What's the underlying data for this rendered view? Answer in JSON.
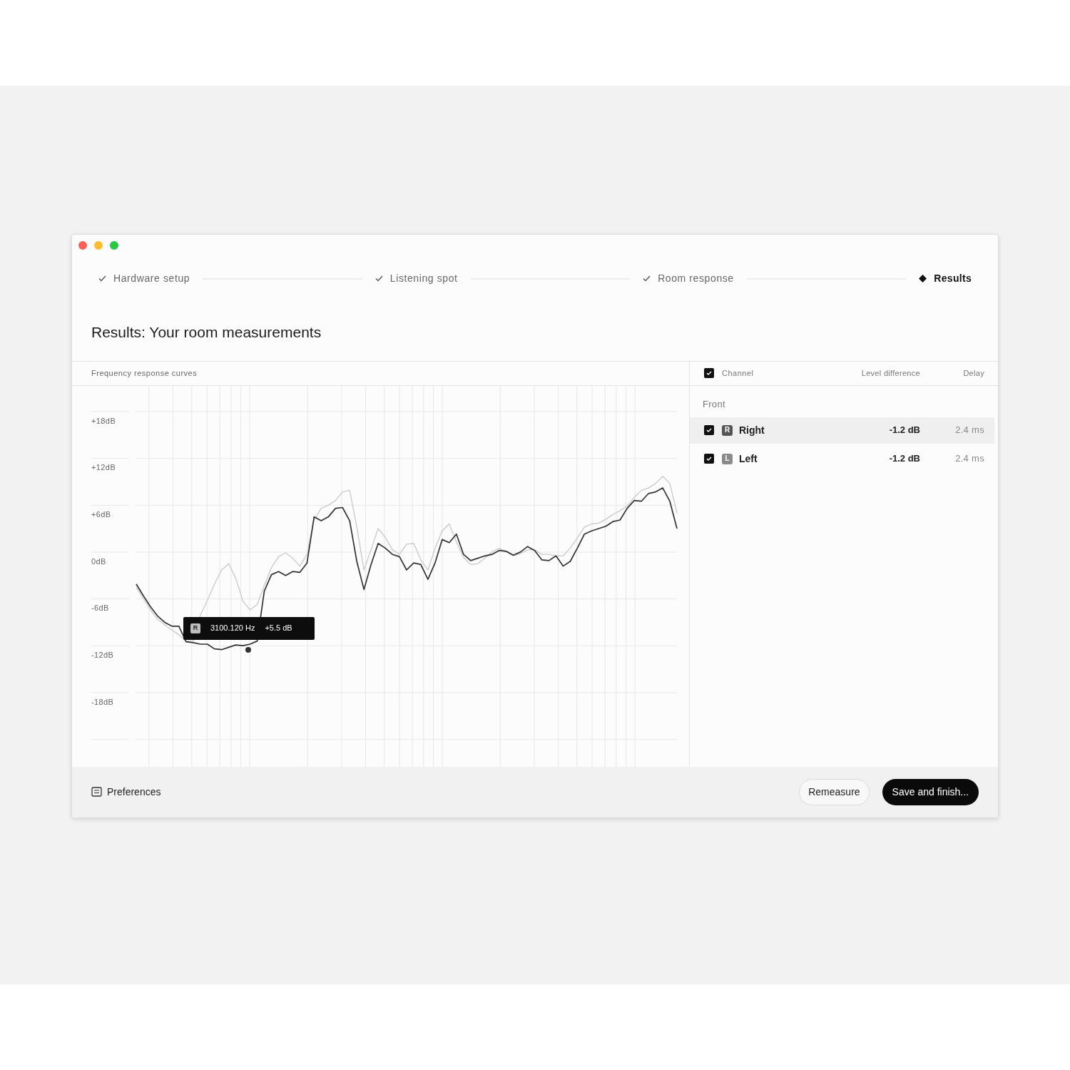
{
  "window_controls": [
    {
      "color": "#fe5f57"
    },
    {
      "color": "#febc2e"
    },
    {
      "color": "#28c840"
    }
  ],
  "steps": [
    {
      "label": "Hardware setup",
      "completed": true,
      "current": false
    },
    {
      "label": "Listening spot",
      "completed": true,
      "current": false
    },
    {
      "label": "Room response",
      "completed": true,
      "current": false
    },
    {
      "label": "Results",
      "completed": false,
      "current": true
    }
  ],
  "title": "Results: Your room measurements",
  "chart_panel": {
    "title": "Frequency response curves",
    "chart_data": {
      "type": "line",
      "grid": true,
      "ylim": [
        -18,
        18
      ],
      "yticks": [
        {
          "value": 18,
          "label": "+18dB"
        },
        {
          "value": 12,
          "label": "+12dB"
        },
        {
          "value": 6,
          "label": "+6dB"
        },
        {
          "value": 0,
          "label": "0dB"
        },
        {
          "value": -6,
          "label": "-6dB"
        },
        {
          "value": -12,
          "label": "-12dB"
        },
        {
          "value": -18,
          "label": "-18dB"
        }
      ],
      "series": [
        {
          "color": "#c9c9c9",
          "values": [
            -3.3,
            -4.8,
            -6.2,
            -7.4,
            -8.1,
            -8.8,
            -9.4,
            -10.2,
            -10.2,
            -6.9,
            -5.0,
            -2.9,
            -1.1,
            -0.3,
            -2.2,
            -5.1,
            -6.2,
            -5.5,
            -3.1,
            -0.8,
            0.6,
            1.1,
            0.4,
            -0.6,
            0.9,
            5.3,
            6.8,
            7.2,
            7.8,
            8.9,
            9.1,
            4.4,
            -1.1,
            1.5,
            4.2,
            3.1,
            1.5,
            0.9,
            2.2,
            2.3,
            0.2,
            -1.1,
            1.7,
            3.9,
            4.8,
            2.5,
            0.5,
            -0.4,
            -0.3,
            0.4,
            1.2,
            1.7,
            1.2,
            0.7,
            1.0,
            1.5,
            1.5,
            0.9,
            0.9,
            0.7,
            0.7,
            1.7,
            3.0,
            4.4,
            4.8,
            4.9,
            5.4,
            6.0,
            6.5,
            7.1,
            8.2,
            9.1,
            9.4,
            10.0,
            10.9,
            10.0,
            6.2
          ]
        },
        {
          "color": "#333333",
          "values": [
            -2.9,
            -4.4,
            -5.8,
            -7.0,
            -7.8,
            -8.3,
            -8.3,
            -10.3,
            -10.4,
            -10.6,
            -10.6,
            -11.2,
            -11.3,
            -11.0,
            -10.7,
            -10.8,
            -10.6,
            -10.2,
            -3.8,
            -1.7,
            -1.3,
            -1.8,
            -1.3,
            -1.4,
            -0.2,
            5.7,
            5.2,
            5.7,
            6.8,
            6.9,
            5.2,
            0.0,
            -3.6,
            -0.4,
            2.3,
            1.7,
            0.9,
            0.6,
            -1.1,
            -0.2,
            -0.4,
            -2.3,
            -0.2,
            2.8,
            2.4,
            3.5,
            0.9,
            0.1,
            0.4,
            0.7,
            0.9,
            1.4,
            1.3,
            0.8,
            1.2,
            1.9,
            1.4,
            0.2,
            0.1,
            0.7,
            -0.6,
            0.0,
            1.7,
            3.5,
            3.9,
            4.2,
            4.5,
            5.1,
            5.3,
            6.8,
            7.8,
            7.7,
            8.7,
            8.9,
            9.4,
            7.7,
            4.2
          ]
        }
      ]
    },
    "tooltip": {
      "channel_badge": "R",
      "frequency": "3100.120 Hz",
      "value": "+5.5 dB"
    }
  },
  "channel_table": {
    "all_checked": true,
    "columns": [
      "Channel",
      "Level difference",
      "Delay"
    ],
    "groups": [
      {
        "label": "Front",
        "rows": [
          {
            "badge": "R",
            "name": "Right",
            "level_difference": "-1.2 dB",
            "delay": "2.4 ms",
            "checked": true,
            "selected": true
          },
          {
            "badge": "L",
            "name": "Left",
            "level_difference": "-1.2 dB",
            "delay": "2.4 ms",
            "checked": true,
            "selected": false
          }
        ]
      }
    ]
  },
  "footer": {
    "preferences": "Preferences",
    "buttons": [
      {
        "label": "Remeasure",
        "kind": "secondary"
      },
      {
        "label": "Save and finish...",
        "kind": "primary"
      }
    ]
  }
}
